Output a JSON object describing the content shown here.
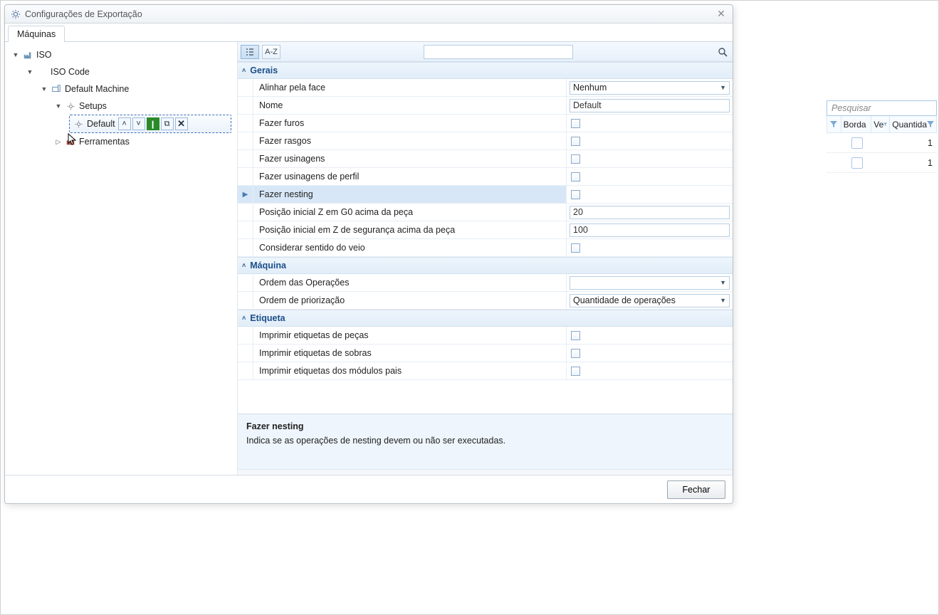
{
  "dialog": {
    "title": "Configurações de Exportação",
    "tab": "Máquinas",
    "close_button_title": "Fechar"
  },
  "tree": {
    "root": "ISO",
    "child1": "ISO Code",
    "child2": "Default Machine",
    "setups": "Setups",
    "selected": "Default",
    "ferramentas": "Ferramentas"
  },
  "toolbar": {
    "sort_label": "A-Z",
    "search_value": ""
  },
  "categories": {
    "gerais": "Gerais",
    "maquina": "Máquina",
    "etiqueta": "Etiqueta"
  },
  "props": {
    "alinhar_face": {
      "label": "Alinhar pela face",
      "value": "Nenhum"
    },
    "nome": {
      "label": "Nome",
      "value": "Default"
    },
    "fazer_furos": {
      "label": "Fazer furos",
      "checked": false
    },
    "fazer_rasgos": {
      "label": "Fazer rasgos",
      "checked": false
    },
    "fazer_usinagens": {
      "label": "Fazer usinagens",
      "checked": false
    },
    "fazer_usinagens_perfil": {
      "label": "Fazer usinagens de perfil",
      "checked": false
    },
    "fazer_nesting": {
      "label": "Fazer nesting",
      "checked": false
    },
    "pos_z_g0": {
      "label": "Posição inicial Z em G0 acima da peça",
      "value": "20"
    },
    "pos_z_seg": {
      "label": "Posição inicial em Z de segurança acima da peça",
      "value": "100"
    },
    "considerar_veio": {
      "label": "Considerar sentido do veio",
      "checked": false
    },
    "ordem_operacoes": {
      "label": "Ordem das Operações",
      "value": ""
    },
    "ordem_prior": {
      "label": "Ordem de priorização",
      "value": "Quantidade de operações"
    },
    "imp_pecas": {
      "label": "Imprimir etiquetas de peças",
      "checked": false
    },
    "imp_sobras": {
      "label": "Imprimir etiquetas de sobras",
      "checked": false
    },
    "imp_modulos": {
      "label": "Imprimir etiquetas dos módulos pais",
      "checked": false
    }
  },
  "description": {
    "title": "Fazer nesting",
    "body": "Indica se as operações de nesting devem ou não ser executadas."
  },
  "search_placeholder": "Pesquisar",
  "bg_headers": {
    "borda": "Borda",
    "ve": "Ve",
    "quantida": "Quantida"
  },
  "bg_rows": [
    {
      "quantity": "1"
    },
    {
      "quantity": "1"
    }
  ],
  "close_button": "Fechar"
}
